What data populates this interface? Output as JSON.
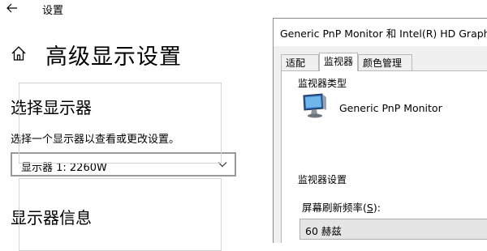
{
  "settings": {
    "window_title": "设置",
    "page_title": "高级显示设置",
    "select_heading": "选择显示器",
    "select_description": "选择一个显示器以查看或更改设置。",
    "display_dropdown_value": "显示器 1: 2260W",
    "info_heading": "显示器信息"
  },
  "dialog": {
    "title": "Generic PnP Monitor 和 Intel(R) HD Graphics",
    "tabs": [
      "适配器",
      "监视器",
      "颜色管理"
    ],
    "active_tab": "监视器",
    "monitor_type_label": "监视器类型",
    "monitor_name": "Generic PnP Monitor",
    "monitor_settings_label": "监视器设置",
    "refresh_label_prefix": "屏幕刷新频率(",
    "refresh_label_key": "S",
    "refresh_label_suffix": "):",
    "refresh_value": "60 赫兹"
  },
  "icons": [
    "back-arrow-icon",
    "home-icon",
    "chevron-down-icon",
    "monitor-icon"
  ]
}
